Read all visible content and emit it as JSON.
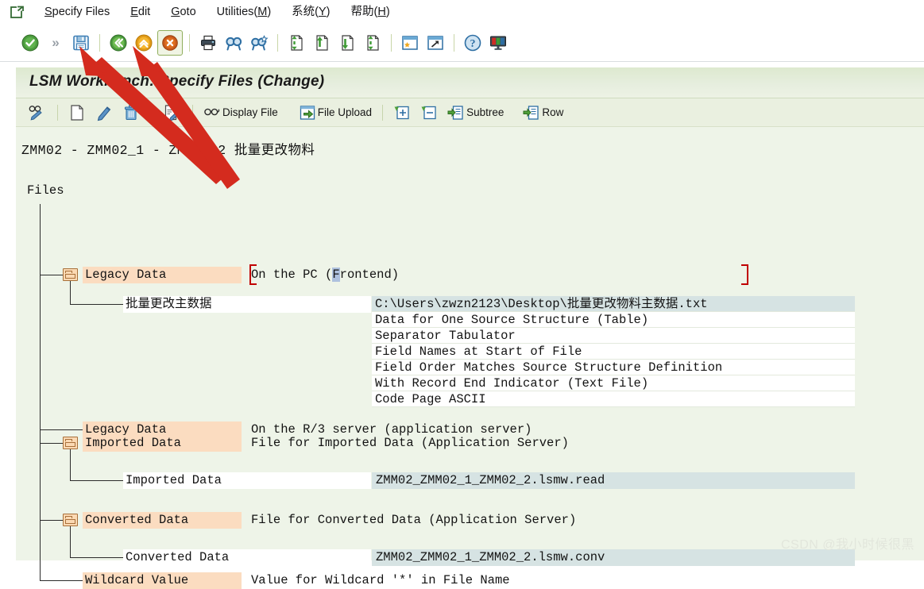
{
  "menu": {
    "exit_icon": "sap-exit-icon",
    "items": [
      {
        "label": "Specify Files",
        "accel": "S"
      },
      {
        "label": "Edit",
        "accel": "E"
      },
      {
        "label": "Goto",
        "accel": "G"
      },
      {
        "label": "Utilities(M)",
        "accel": "M"
      },
      {
        "label": "系统(Y)",
        "accel": "Y"
      },
      {
        "label": "帮助(H)",
        "accel": "H"
      }
    ]
  },
  "toolbar": {
    "buttons": [
      {
        "name": "enter-check-icon",
        "title": "Enter"
      },
      {
        "name": "more-chevron-icon",
        "title": "More"
      },
      {
        "name": "save-icon",
        "title": "Save"
      },
      {
        "name": "back-icon",
        "title": "Back"
      },
      {
        "name": "exit-up-icon",
        "title": "Exit"
      },
      {
        "name": "cancel-icon",
        "title": "Cancel"
      },
      {
        "name": "print-icon",
        "title": "Print"
      },
      {
        "name": "find-icon",
        "title": "Find"
      },
      {
        "name": "find-next-icon",
        "title": "Find Next"
      },
      {
        "name": "first-page-icon",
        "title": "First Page"
      },
      {
        "name": "previous-page-icon",
        "title": "Previous Page"
      },
      {
        "name": "next-page-icon",
        "title": "Next Page"
      },
      {
        "name": "last-page-icon",
        "title": "Last Page"
      },
      {
        "name": "create-session-icon",
        "title": "Create Session"
      },
      {
        "name": "create-shortcut-icon",
        "title": "Create Shortcut"
      },
      {
        "name": "help-icon",
        "title": "Help"
      },
      {
        "name": "customize-layout-icon",
        "title": "Customize Local Layout"
      }
    ]
  },
  "window": {
    "title": "LSM Workbench: Specify Files (Change)"
  },
  "app_toolbar": {
    "items": [
      {
        "name": "display-change-button",
        "icon": "glasses-pencil-icon",
        "label": ""
      },
      {
        "name": "new-entry-button",
        "icon": "new-document-icon",
        "label": ""
      },
      {
        "name": "change-entry-button",
        "icon": "pencil-icon",
        "label": ""
      },
      {
        "name": "delete-entry-button",
        "icon": "trash-icon",
        "label": ""
      },
      {
        "name": "edit-document-button",
        "icon": "document-pencil-icon",
        "label": ""
      },
      {
        "name": "display-file-button",
        "icon": "glasses-icon",
        "label": "Display File"
      },
      {
        "name": "file-upload-button",
        "icon": "upload-icon",
        "label": "File Upload"
      },
      {
        "name": "expand-all-button",
        "icon": "expand-plus-icon",
        "label": ""
      },
      {
        "name": "collapse-all-button",
        "icon": "collapse-minus-icon",
        "label": ""
      },
      {
        "name": "subtree-button",
        "icon": "subtree-icon",
        "label": "Subtree"
      },
      {
        "name": "row-button",
        "icon": "row-icon",
        "label": "Row"
      }
    ]
  },
  "breadcrumb": "ZMM02 - ZMM02_1 - ZMM02_2 批量更改物料",
  "tree": {
    "root_label": "Files",
    "nodes": [
      {
        "name": "legacy-data-frontend",
        "label": "Legacy Data",
        "description_before_cursor": "On the PC (",
        "cursor_char": "F",
        "description_after_cursor": "rontend)",
        "selected": true,
        "child": {
          "name": "legacy-data-file",
          "label": "批量更改主数据",
          "value": "C:\\Users\\zwzn2123\\Desktop\\批量更改物料主数据.txt"
        },
        "details": [
          "Data for One Source Structure (Table)",
          "Separator Tabulator",
          "Field Names at Start of File",
          "Field Order Matches Source Structure Definition",
          "With Record End Indicator (Text File)",
          "Code Page ASCII"
        ]
      },
      {
        "name": "legacy-data-server",
        "label": "Legacy Data",
        "description": "On the R/3 server (application server)"
      },
      {
        "name": "imported-data",
        "label": "Imported Data",
        "description": "File for Imported Data (Application Server)",
        "child": {
          "name": "imported-data-file",
          "label": "Imported Data",
          "value": "ZMM02_ZMM02_1_ZMM02_2.lsmw.read"
        }
      },
      {
        "name": "converted-data",
        "label": "Converted Data",
        "description": "File for Converted Data (Application Server)",
        "child": {
          "name": "converted-data-file",
          "label": "Converted Data",
          "value": "ZMM02_ZMM02_1_ZMM02_2.lsmw.conv"
        }
      },
      {
        "name": "wildcard-value",
        "label": "Wildcard Value",
        "description": "Value for Wildcard '*' in File Name"
      }
    ]
  },
  "annotations": {
    "arrow_color": "#d42b1e",
    "arrow_targets": [
      "save-icon",
      "exit-up-icon"
    ]
  },
  "watermark": "CSDN @我小时候很黑",
  "colors": {
    "panel_bg": "#eef4e8",
    "title_band": "#dde9cf",
    "node_label_bg": "#fbdcc0",
    "value_field_bg": "#d6e3e3",
    "selection_red": "#c00000",
    "cursor_blue": "#aec1de"
  }
}
